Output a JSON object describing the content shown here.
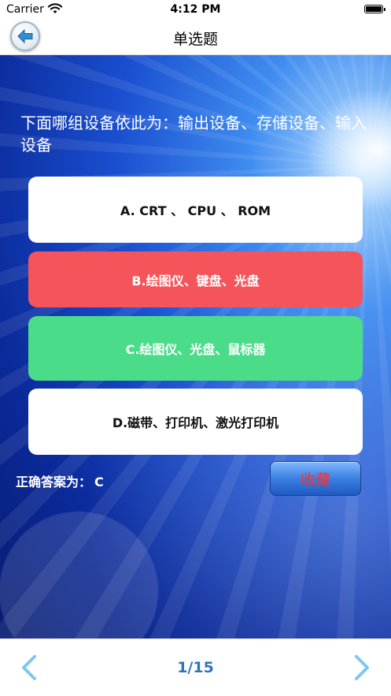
{
  "status_bar": {
    "carrier": "Carrier",
    "time": "4:12 PM"
  },
  "nav": {
    "title": "单选题",
    "back_icon": "back-arrow-icon"
  },
  "question": {
    "text": "下面哪组设备依此为：输出设备、存储设备、输入设备"
  },
  "options": [
    {
      "label": "A. CRT 、 CPU 、 ROM",
      "state": "default"
    },
    {
      "label": "B.绘图仪、键盘、光盘",
      "state": "wrong"
    },
    {
      "label": "C.绘图仪、光盘、鼠标器",
      "state": "correct"
    },
    {
      "label": "D.磁带、打印机、激光打印机",
      "state": "default"
    }
  ],
  "answer": {
    "label": "正确答案为：",
    "value": "C"
  },
  "favorite": {
    "label": "收藏"
  },
  "pagination": {
    "text": "1/15",
    "prev_icon": "chevron-left-icon",
    "next_icon": "chevron-right-icon"
  },
  "colors": {
    "wrong": "#f4545a",
    "correct": "#4bdc89",
    "page_indicator": "#2d74b8",
    "chevron": "#7fc6ee",
    "favorite_text": "#ff2d2d"
  }
}
